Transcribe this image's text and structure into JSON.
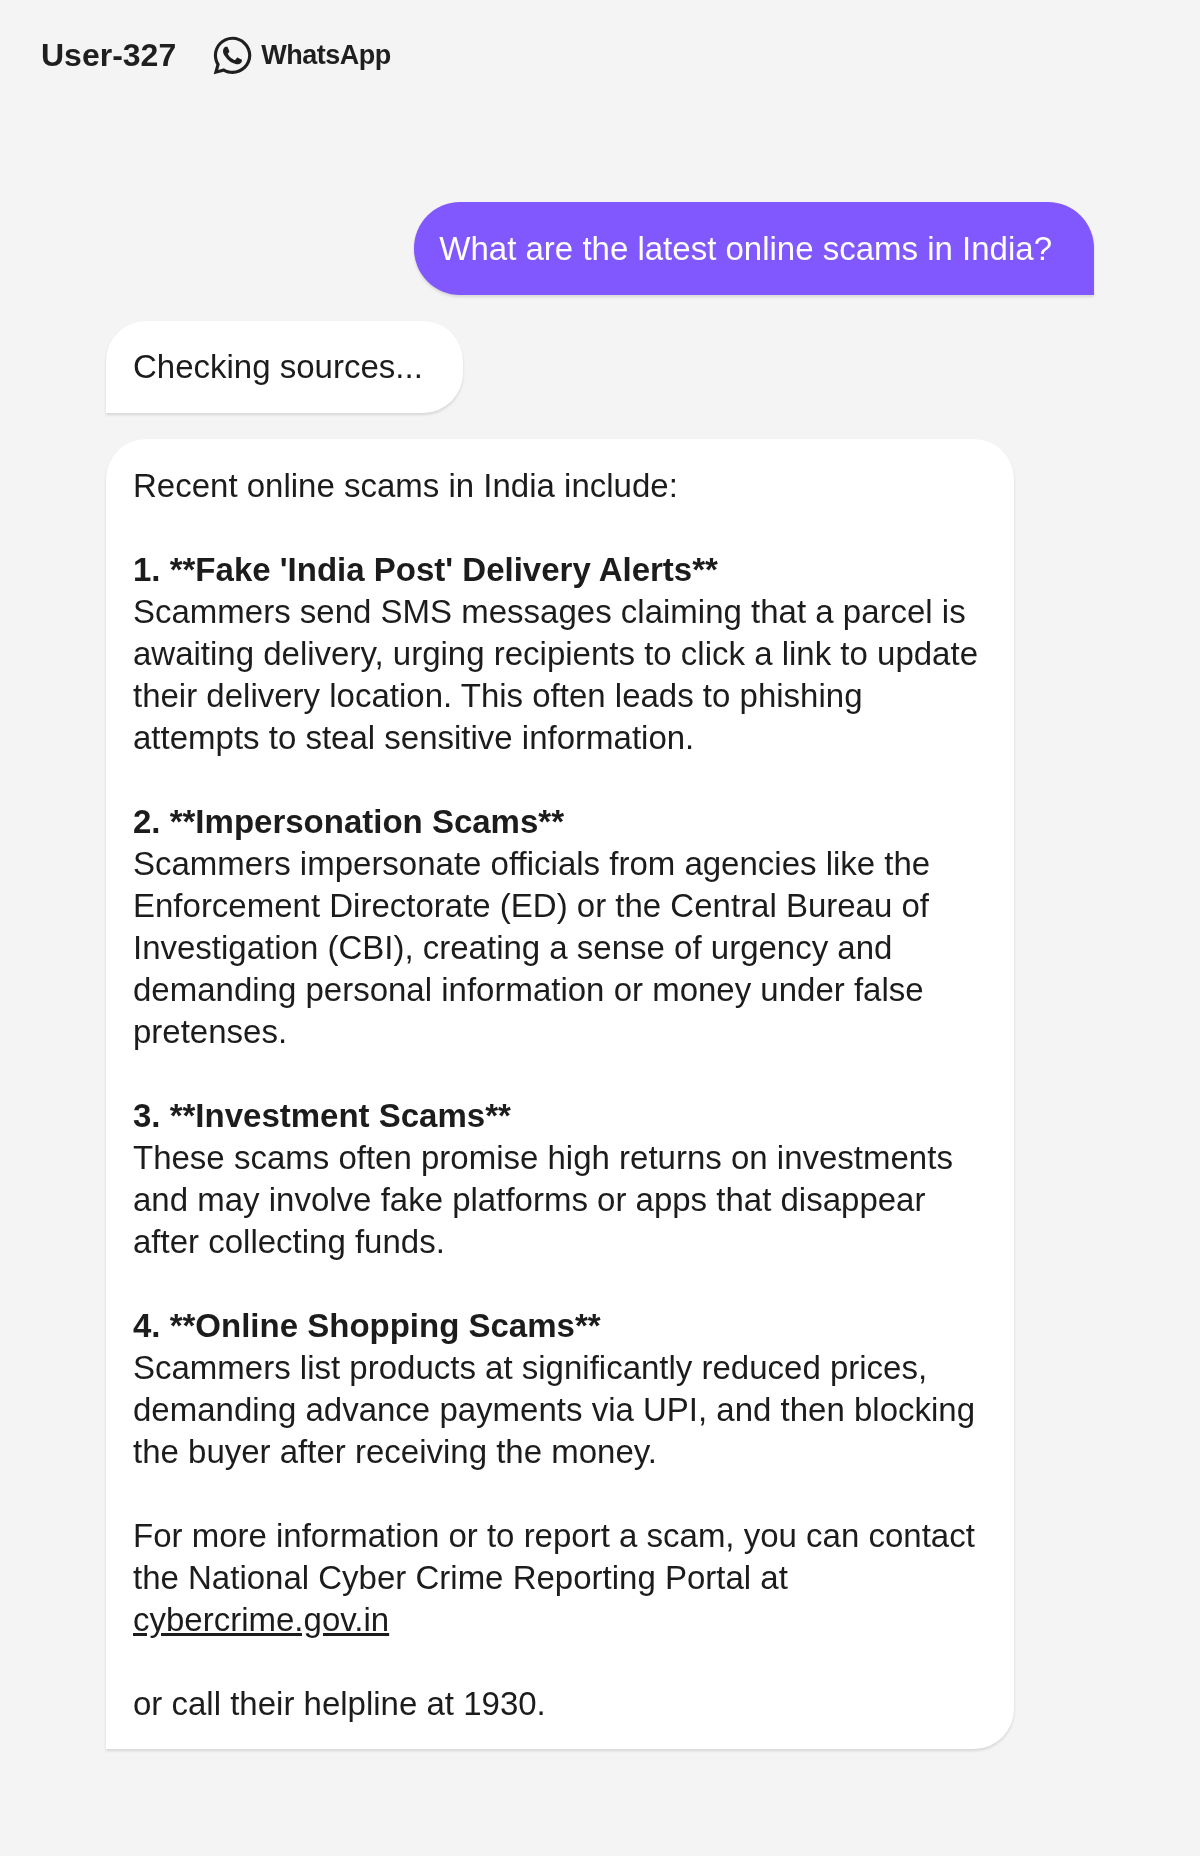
{
  "header": {
    "user": "User-327",
    "channel": "WhatsApp"
  },
  "messages": [
    {
      "kind": "sent",
      "text": "What are the latest online scams in India?"
    },
    {
      "kind": "status",
      "text": "Checking sources..."
    },
    {
      "kind": "reply",
      "blocks": [
        {
          "kind": "paragraph",
          "text": "Recent online scams in India include:"
        },
        {
          "kind": "item",
          "heading": "1. **Fake 'India Post' Delivery Alerts**",
          "text": "Scammers send SMS messages claiming that a parcel is awaiting delivery, urging recipients to click a link to update their delivery location. This often leads to phishing attempts to steal sensitive information."
        },
        {
          "kind": "item",
          "heading": "2. **Impersonation Scams**",
          "text": "Scammers impersonate officials from agencies like the Enforcement Directorate (ED) or the Central Bureau of Investigation (CBI), creating a sense of urgency and demanding personal information or money under false pretenses."
        },
        {
          "kind": "item",
          "heading": "3. **Investment Scams**",
          "text": "These scams often promise high returns on investments and may involve fake platforms or apps that disappear after collecting funds."
        },
        {
          "kind": "item",
          "heading": "4. **Online Shopping Scams**",
          "text": "Scammers list products at significantly reduced prices, demanding advance payments via UPI, and then blocking the buyer after receiving the money."
        },
        {
          "kind": "paragraph",
          "text": "For more information or to report a scam, you can contact the National Cyber Crime Reporting Portal at",
          "link": "cybercrime.gov.in"
        },
        {
          "kind": "paragraph",
          "text": "or call their helpline at 1930."
        }
      ]
    }
  ]
}
